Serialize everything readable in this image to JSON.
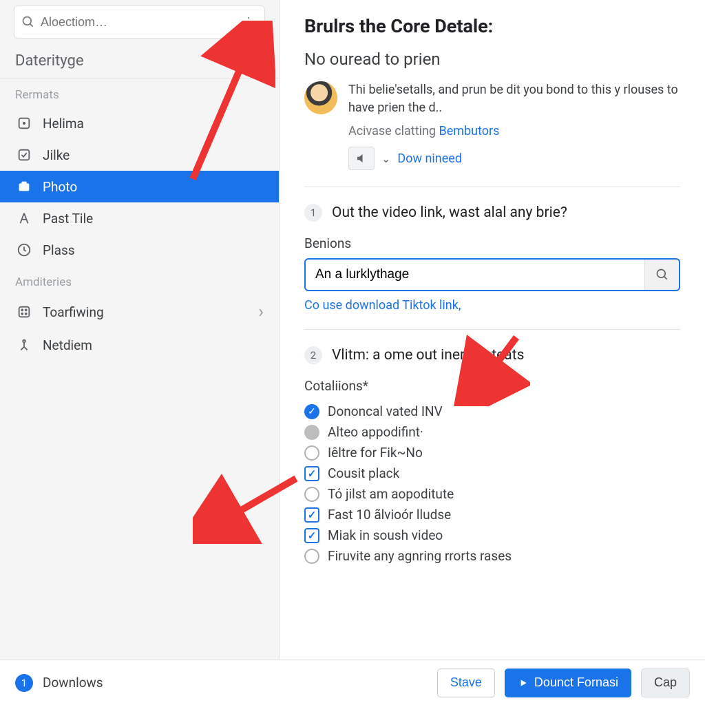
{
  "search": {
    "placeholder": "Aloectiom…"
  },
  "sidebar": {
    "section_title": "Daterityge",
    "group1_label": "Rermats",
    "items1": [
      {
        "label": "Helima"
      },
      {
        "label": "Jilke"
      },
      {
        "label": "Photo"
      },
      {
        "label": "Past Tile"
      },
      {
        "label": "Plass"
      }
    ],
    "group2_label": "Amditeries",
    "items2": [
      {
        "label": "Toarfiwing"
      },
      {
        "label": "Netdiem"
      }
    ]
  },
  "main": {
    "title": "Brulrs the Core Detale:",
    "subtitle": "No ouread to prien",
    "intro_text": "Thi belie'setalls, and prun be dit you bond to this y rlouses to have prien the d..",
    "intro_sub_prefix": "Acivase clatting ",
    "intro_sub_link": "Bembutors",
    "intro_action": "Dow nineed",
    "step1": {
      "num": "1",
      "text": "Out the video link, wast alal any brie?"
    },
    "field1_label": "Benions",
    "field1_value": "An a lurklythage",
    "hint_link": "Co use download Tiktok link,",
    "step2": {
      "num": "2",
      "text": "Vlitm: a ome out inera beteats"
    },
    "options_label": "Cotaliions*",
    "options": [
      {
        "kind": "radio-blue",
        "label": "Dononcal vated INV"
      },
      {
        "kind": "radio-grey",
        "label": "Alteo appodifint·"
      },
      {
        "kind": "radio",
        "label": "Iêltre for Fik~No"
      },
      {
        "kind": "check-on",
        "label": "Cousit plack"
      },
      {
        "kind": "radio",
        "label": "Tó jilst am aopoditute"
      },
      {
        "kind": "check-on",
        "label": "Fast 10 ãlvioór lludse"
      },
      {
        "kind": "check-on",
        "label": "Miak in soush video"
      },
      {
        "kind": "radio",
        "label": "Firuvite any agnring rrorts rases"
      }
    ]
  },
  "footer": {
    "count": "1",
    "label": "Downlows",
    "save": "Stave",
    "primary": "Dounct Fornasi",
    "cap": "Cap"
  }
}
